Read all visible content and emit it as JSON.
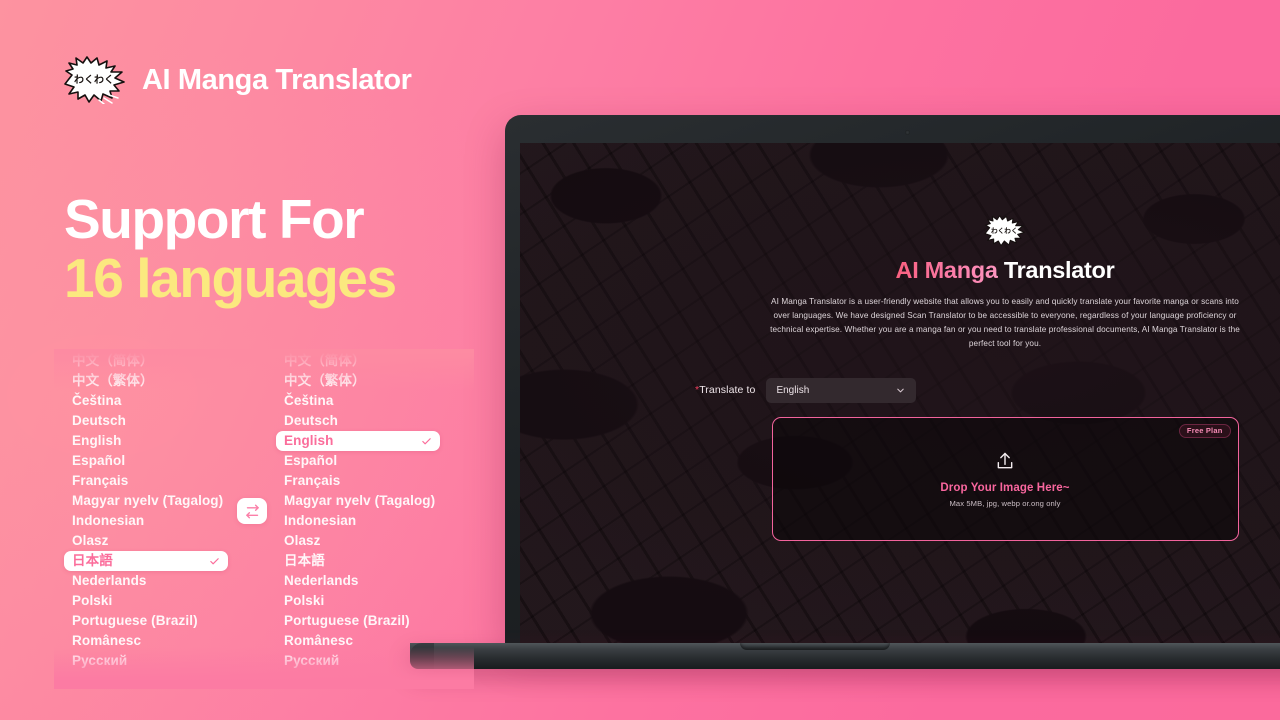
{
  "brand": {
    "name": "AI Manga Translator",
    "logo_icon": "manga-burst-logo",
    "logo_text": "わくわく"
  },
  "headline": {
    "line1": "Support For",
    "line2": "16 languages",
    "line1_color": "#ffffff",
    "line2_color": "#fbe97f"
  },
  "languages": {
    "source_list": [
      {
        "label": "中文（简体）",
        "selected": false
      },
      {
        "label": "中文（繁体）",
        "selected": false
      },
      {
        "label": "Čeština",
        "selected": false
      },
      {
        "label": "Deutsch",
        "selected": false
      },
      {
        "label": "English",
        "selected": false
      },
      {
        "label": "Español",
        "selected": false
      },
      {
        "label": "Français",
        "selected": false
      },
      {
        "label": "Magyar nyelv (Tagalog)",
        "selected": false
      },
      {
        "label": "Indonesian",
        "selected": false
      },
      {
        "label": "Olasz",
        "selected": false
      },
      {
        "label": "日本語",
        "selected": true
      },
      {
        "label": "Nederlands",
        "selected": false
      },
      {
        "label": "Polski",
        "selected": false
      },
      {
        "label": "Portuguese (Brazil)",
        "selected": false
      },
      {
        "label": "Românesc",
        "selected": false
      },
      {
        "label": "Русский",
        "selected": false
      }
    ],
    "target_list": [
      {
        "label": "中文（简体）",
        "selected": false
      },
      {
        "label": "中文（繁体）",
        "selected": false
      },
      {
        "label": "Čeština",
        "selected": false
      },
      {
        "label": "Deutsch",
        "selected": false
      },
      {
        "label": "English",
        "selected": true
      },
      {
        "label": "Español",
        "selected": false
      },
      {
        "label": "Français",
        "selected": false
      },
      {
        "label": "Magyar nyelv (Tagalog)",
        "selected": false
      },
      {
        "label": "Indonesian",
        "selected": false
      },
      {
        "label": "Olasz",
        "selected": false
      },
      {
        "label": "日本語",
        "selected": false
      },
      {
        "label": "Nederlands",
        "selected": false
      },
      {
        "label": "Polski",
        "selected": false
      },
      {
        "label": "Portuguese (Brazil)",
        "selected": false
      },
      {
        "label": "Românesc",
        "selected": false
      },
      {
        "label": "Русский",
        "selected": false
      }
    ],
    "swap_icon": "swap-arrows-icon",
    "selected_pill_bg": "#ffffff",
    "selected_pill_text": "#fb6d9b"
  },
  "laptop": {
    "site": {
      "logo_icon": "manga-burst-logo",
      "title_accent": "AI Manga",
      "title_plain": " Translator",
      "description": "AI Manga Translator is a user-friendly website that allows you to easily and quickly translate your favorite manga or scans into over languages. We have designed Scan Translator to be accessible to everyone, regardless of your language proficiency or technical expertise. Whether you are a manga fan or you need to translate professional documents, AI Manga Translator is the perfect tool for you.",
      "translate_to": {
        "asterisk": "*",
        "label": "Translate to",
        "value": "English",
        "chevron_icon": "chevron-down-icon"
      },
      "dropzone": {
        "plan_badge": "Free Plan",
        "upload_icon": "upload-icon",
        "title": "Drop Your Image Here~",
        "subtitle": "Max 5MB, jpg, webp or.ong only",
        "border_color": "#f2639c",
        "title_color": "#f9669e"
      }
    }
  }
}
